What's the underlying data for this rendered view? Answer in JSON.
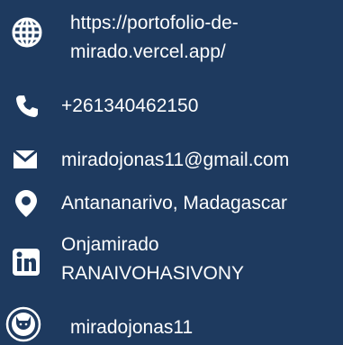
{
  "contacts": {
    "website": {
      "line1": "https://portofolio-de-",
      "line2": "mirado.vercel.app/",
      "icon": "globe-icon"
    },
    "phone": {
      "value": "+261340462150",
      "icon": "phone-icon"
    },
    "email": {
      "value": "miradojonas11@gmail.com",
      "icon": "envelope-icon"
    },
    "location": {
      "value": "Antananarivo, Madagascar",
      "icon": "map-pin-icon"
    },
    "linkedin": {
      "line1": "Onjamirado",
      "line2": "RANAIVOHASIVONY",
      "icon": "linkedin-icon",
      "icon_text": "in"
    },
    "github": {
      "value": "miradojonas11",
      "icon": "github-icon"
    }
  },
  "colors": {
    "background": "#1e3a5f",
    "text": "#ffffff"
  }
}
